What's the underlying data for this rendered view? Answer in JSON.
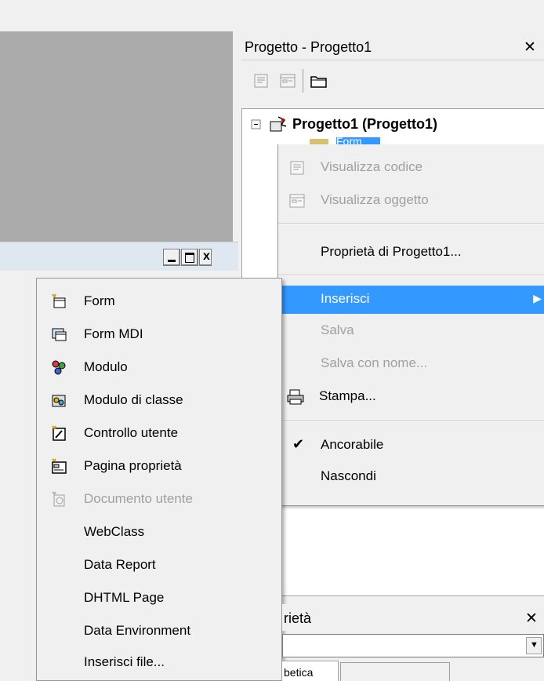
{
  "project_panel": {
    "title": "Progetto - Progetto1",
    "tree_root": "Progetto1 (Progetto1)",
    "tree_child": "Form"
  },
  "context_menu": {
    "items": [
      {
        "label": "Visualizza codice",
        "disabled": true,
        "icon": "view-code-icon"
      },
      {
        "label": "Visualizza oggetto",
        "disabled": true,
        "icon": "view-object-icon"
      },
      {
        "label": "Proprietà di Progetto1...",
        "disabled": false
      },
      {
        "label": "Inserisci",
        "disabled": false,
        "highlighted": true,
        "submenu": true
      },
      {
        "label": "Salva",
        "disabled": true
      },
      {
        "label": "Salva con nome...",
        "disabled": true
      },
      {
        "label": "Stampa...",
        "disabled": false,
        "icon": "printer-icon"
      },
      {
        "label": "Ancorabile",
        "disabled": false,
        "checked": true
      },
      {
        "label": "Nascondi",
        "disabled": false
      }
    ]
  },
  "submenu": {
    "items": [
      {
        "label": "Form",
        "disabled": false,
        "icon": "form-icon"
      },
      {
        "label": "Form MDI",
        "disabled": false,
        "icon": "form-mdi-icon"
      },
      {
        "label": "Modulo",
        "disabled": false,
        "icon": "module-icon"
      },
      {
        "label": "Modulo di classe",
        "disabled": false,
        "icon": "class-module-icon"
      },
      {
        "label": "Controllo utente",
        "disabled": false,
        "icon": "user-control-icon"
      },
      {
        "label": "Pagina proprietà",
        "disabled": false,
        "icon": "property-page-icon"
      },
      {
        "label": "Documento utente",
        "disabled": true,
        "icon": "user-document-icon"
      },
      {
        "label": "WebClass",
        "disabled": false
      },
      {
        "label": "Data Report",
        "disabled": false
      },
      {
        "label": "DHTML Page",
        "disabled": false
      },
      {
        "label": "Data Environment",
        "disabled": false
      },
      {
        "label": "Inserisci file...",
        "disabled": false
      }
    ]
  },
  "properties_panel": {
    "title_partial": "rietà",
    "tab_partial": "betica"
  },
  "colors": {
    "highlight": "#3399ff",
    "disabled_text": "#a0a0a0",
    "menu_bg": "#f0f0f0"
  }
}
